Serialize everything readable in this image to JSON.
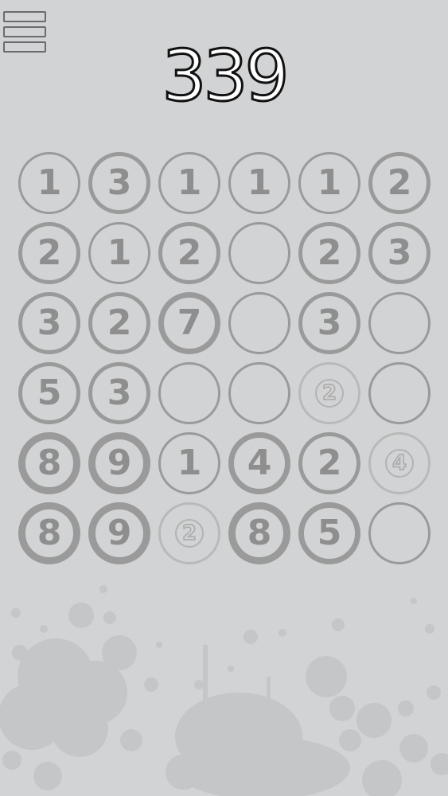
{
  "score": "339",
  "menu": {
    "icon": "hamburger-menu-icon"
  },
  "colors": {
    "background": "#d1d3d4",
    "ring": "#9a9a9a",
    "digit": "#8e8e8e",
    "score_text": "#ffffff",
    "score_outline": "#111111",
    "splatter": "#c4c6c7"
  },
  "board": {
    "rows": 6,
    "cols": 6,
    "cells": [
      [
        {
          "value": "1",
          "weight": 1
        },
        {
          "value": "3",
          "weight": 2
        },
        {
          "value": "1",
          "weight": 1
        },
        {
          "value": "1",
          "weight": 1
        },
        {
          "value": "1",
          "weight": 1
        },
        {
          "value": "2",
          "weight": 2
        }
      ],
      [
        {
          "value": "2",
          "weight": 2
        },
        {
          "value": "1",
          "weight": 1
        },
        {
          "value": "2",
          "weight": 2
        },
        {
          "value": "",
          "weight": 1
        },
        {
          "value": "2",
          "weight": 2
        },
        {
          "value": "3",
          "weight": 2
        }
      ],
      [
        {
          "value": "3",
          "weight": 2
        },
        {
          "value": "2",
          "weight": 2
        },
        {
          "value": "7",
          "weight": 3
        },
        {
          "value": "",
          "weight": 1
        },
        {
          "value": "3",
          "weight": 2
        },
        {
          "value": "",
          "weight": 1
        }
      ],
      [
        {
          "value": "5",
          "weight": 2
        },
        {
          "value": "3",
          "weight": 2
        },
        {
          "value": "",
          "weight": 1
        },
        {
          "value": "",
          "weight": 1
        },
        {
          "value": "2",
          "weight": 1,
          "ghost": true
        },
        {
          "value": "",
          "weight": 1
        }
      ],
      [
        {
          "value": "8",
          "weight": 4
        },
        {
          "value": "9",
          "weight": 4
        },
        {
          "value": "1",
          "weight": 1
        },
        {
          "value": "4",
          "weight": 3
        },
        {
          "value": "2",
          "weight": 2
        },
        {
          "value": "4",
          "weight": 1,
          "ghost": true
        }
      ],
      [
        {
          "value": "8",
          "weight": 4
        },
        {
          "value": "9",
          "weight": 4
        },
        {
          "value": "2",
          "weight": 1,
          "ghost": true
        },
        {
          "value": "8",
          "weight": 4
        },
        {
          "value": "5",
          "weight": 3
        },
        {
          "value": "",
          "weight": 1
        }
      ]
    ]
  }
}
